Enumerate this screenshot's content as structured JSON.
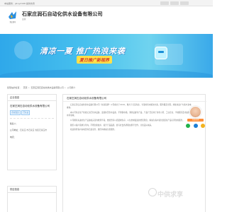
{
  "topbar": {
    "welcome_text": "本站服务：jstuyd168 提供支持"
  },
  "header": {
    "logo_label": "淘宝找号",
    "company_name": "石家庄润石自动化供水设备有限公司",
    "tag": "主营"
  },
  "banner": {
    "headline": "清凉一夏 推广热浪来袭",
    "subline": "夏日推广新视界"
  },
  "breadcrumb": {
    "items": [
      "您现在的位置",
      "首页",
      "石家庄润石自动化供水设备有限公司",
      "公司简介"
    ]
  },
  "sidebar": {
    "info_title": "企业信息",
    "company": "石家庄润石自动化供水设备有限公司",
    "cert_badges": [
      "企业会员",
      "已认证"
    ],
    "contact_label": "联系人：",
    "contact_value": "",
    "address_label": "公司地址：",
    "address_value": "石家庄 市石家庄 省区石家庄市",
    "phone_label": "电话：",
    "phone_value": "",
    "news_title": "供应信息"
  },
  "content": {
    "title": "石家庄润石自动化供水设备有限公司",
    "paragraphs": [
      "石家庄润石自动化供水设备有限公司（前身铭牌）公司成立于XXXX，致力于打造专业、可靠的供水解决方案，服务覆盖全国，热忱欢迎广大客户来电垂询。",
      "本公司专业生产各类无负压供水设备、变频恒压供水设备、不锈钢水箱、消防设备等产品，产品广泛应用于住宅小区、工业企业、学校医院及市政供水等领域。",
      "公司拥有先进的生产设备和完善的检测手段，始终坚持以质量求生存、以信誉求发展的经营理念，竭诚为客户提供优质的产品与周到的服务。",
      "我们以客户需求为导向，不断创新技术，提升产品品质，愿与社会各界朋友携手合作，共创美好未来。",
      "欢迎新老客户来电咨询洽谈业务，我们将竭诚为您服务。"
    ]
  },
  "widget": {
    "badge": "在线咨询"
  },
  "watermark": "中供求享",
  "colors": {
    "banner_start": "#2fa8ea",
    "banner_end": "#3aa9e9",
    "accent_orange": "#ff8f3a"
  }
}
